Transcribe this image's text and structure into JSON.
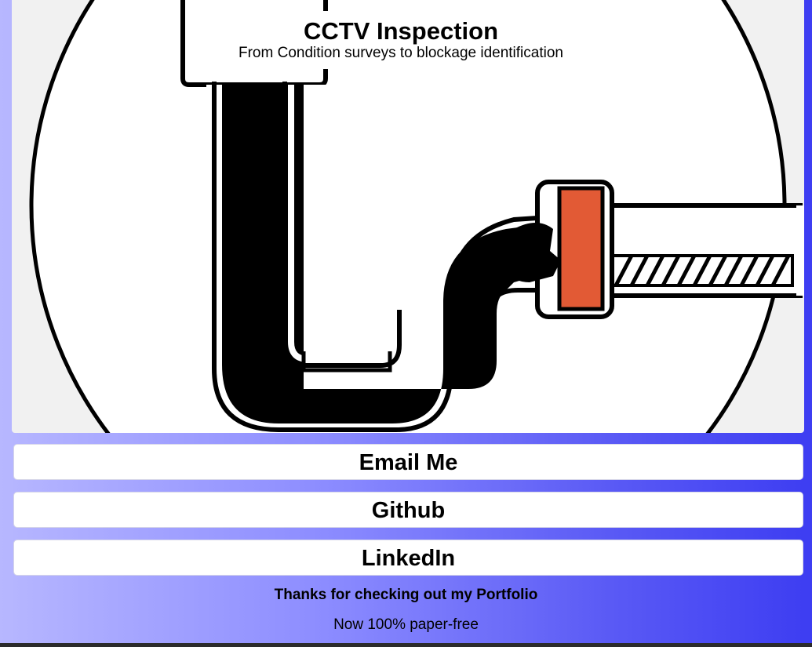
{
  "card": {
    "title": "CCTV Inspection",
    "subtitle": "From Condition surveys to blockage identification",
    "image_icon": "blocked-pipe-illustration"
  },
  "links": {
    "email_label": "Email Me",
    "github_label": "Github",
    "linkedin_label": "LinkedIn"
  },
  "footer": {
    "thanks": "Thanks for checking out my Portfolio",
    "note": "Now 100% paper-free"
  },
  "colors": {
    "background_start": "#b7b7ff",
    "background_end": "#3d3df2",
    "blockage_plug": "#e25a35"
  }
}
